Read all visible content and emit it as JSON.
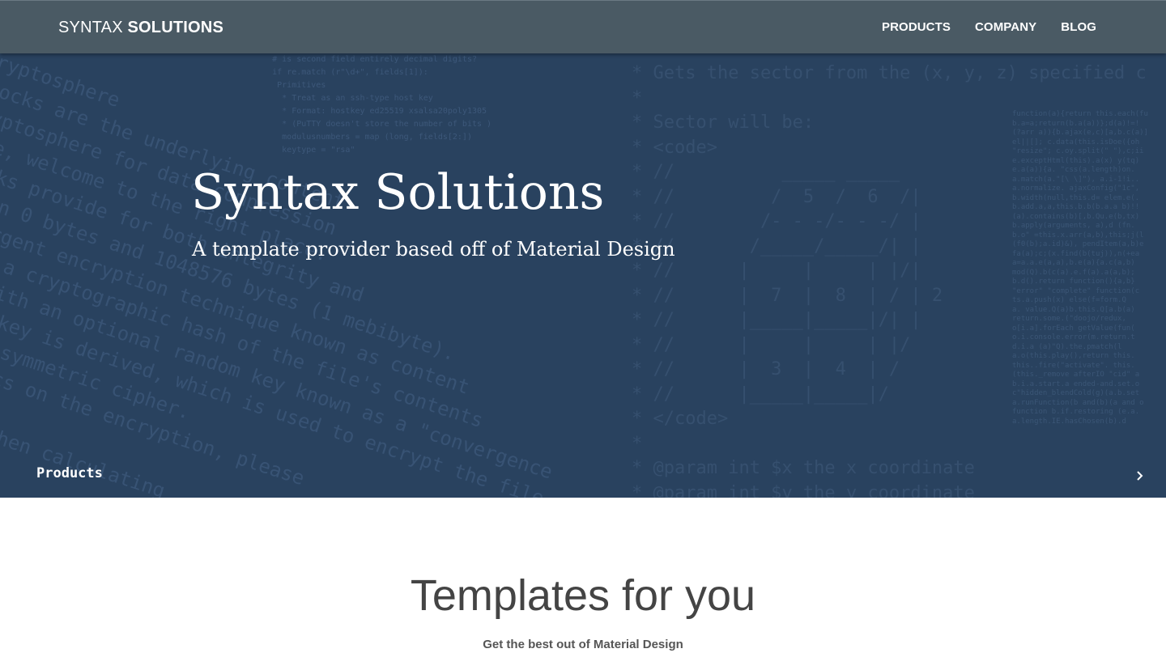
{
  "header": {
    "brand_light": "SYNTAX",
    "brand_bold": "SOLUTIONS",
    "nav": [
      {
        "label": "PRODUCTS"
      },
      {
        "label": "COMPANY"
      },
      {
        "label": "BLOG"
      }
    ]
  },
  "hero": {
    "title": "Syntax Solutions",
    "subtitle": "A template provider based off of Material Design",
    "link_label": "Products",
    "next_icon": "chevron-right-icon"
  },
  "section": {
    "title": "Templates for you",
    "subtitle": "Get the best out of Material Design"
  },
  "colors": {
    "appbar": "#4a5a64",
    "hero_bg": "#29425f",
    "section_text": "#444444"
  }
}
